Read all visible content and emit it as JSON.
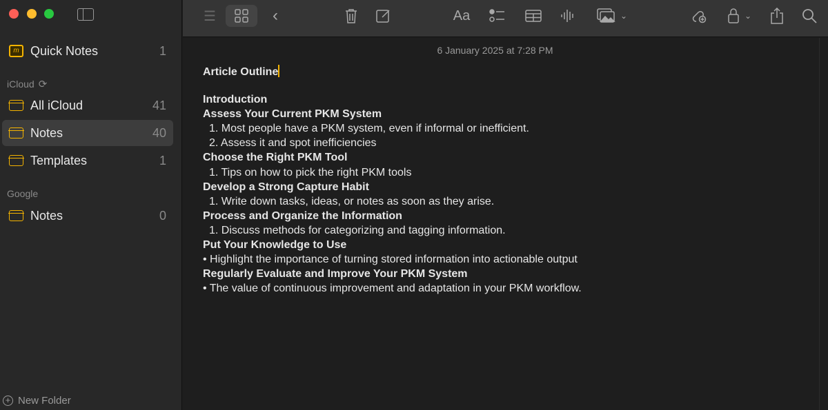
{
  "sidebar": {
    "quick_notes": {
      "label": "Quick Notes",
      "count": "1"
    },
    "icloud_header": "iCloud",
    "icloud_items": [
      {
        "label": "All iCloud",
        "count": "41"
      },
      {
        "label": "Notes",
        "count": "40"
      },
      {
        "label": "Templates",
        "count": "1"
      }
    ],
    "google_header": "Google",
    "google_items": [
      {
        "label": "Notes",
        "count": "0"
      }
    ],
    "new_folder": "New Folder",
    "selected": "Notes (iCloud)"
  },
  "toolbar": {
    "format": "Aa"
  },
  "note": {
    "date": "6 January 2025 at 7:28 PM",
    "title": "Article Outline",
    "lines": [
      {
        "text": "Introduction",
        "bold": true
      },
      {
        "text": "Assess Your Current PKM System",
        "bold": true
      },
      {
        "text": "1. Most people have a PKM system, even if informal or inefficient.",
        "indent": true
      },
      {
        "text": "2. Assess it and spot inefficiencies",
        "indent": true
      },
      {
        "text": "Choose the Right PKM Tool",
        "bold": true
      },
      {
        "text": "1. Tips on how to pick the right PKM tools",
        "indent": true
      },
      {
        "text": "Develop a Strong Capture Habit",
        "bold": true
      },
      {
        "text": "1. Write down tasks, ideas, or notes as soon as they arise.",
        "indent": true
      },
      {
        "text": "Process and Organize the Information",
        "bold": true
      },
      {
        "text": "1. Discuss methods for categorizing and tagging information.",
        "indent": true
      },
      {
        "text": "Put Your Knowledge to Use",
        "bold": true
      },
      {
        "text": "• Highlight the importance of turning stored information into actionable output"
      },
      {
        "text": "Regularly Evaluate and Improve Your PKM System",
        "bold": true
      },
      {
        "text": "• The value of continuous improvement and adaptation in your PKM workflow."
      }
    ]
  },
  "colors": {
    "accent": "#f5b400",
    "close": "#fe5f57",
    "minimize": "#febc2e",
    "zoom": "#28c840"
  }
}
